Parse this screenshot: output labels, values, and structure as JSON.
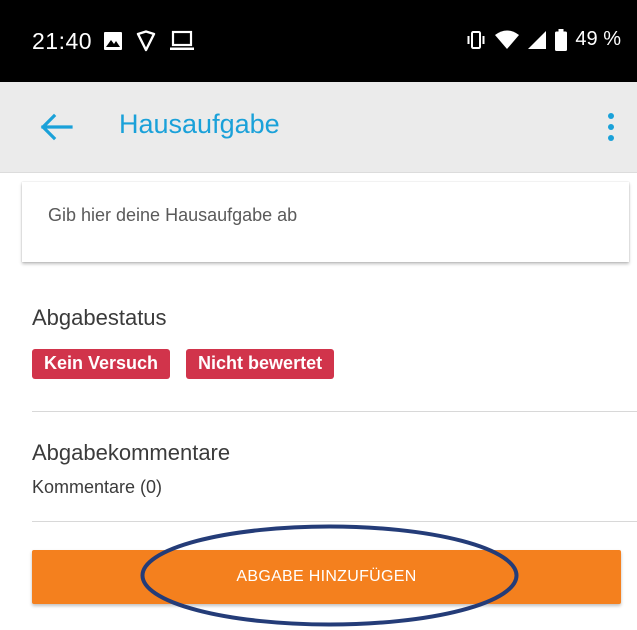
{
  "status_bar": {
    "time": "21:40",
    "battery": "49 %",
    "icons": [
      "image-icon",
      "shield-icon",
      "laptop-icon",
      "vibrate-icon",
      "wifi-icon",
      "signal-icon",
      "battery-icon"
    ]
  },
  "app_bar": {
    "title": "Hausaufgabe",
    "back_icon": "arrow-left-icon",
    "menu_icon": "more-vert-icon",
    "accent_color": "#1aa1d9"
  },
  "intro": {
    "text": "Gib hier deine Hausaufgabe ab"
  },
  "submission_status": {
    "title": "Abgabestatus",
    "badges": [
      "Kein Versuch",
      "Nicht bewertet"
    ],
    "badge_color": "#d1344b"
  },
  "comments": {
    "title": "Abgabekommentare",
    "count_text": "Kommentare (0)"
  },
  "actions": {
    "add_submission_label": "ABGABE HINZUFÜGEN",
    "button_color": "#f4801e"
  }
}
